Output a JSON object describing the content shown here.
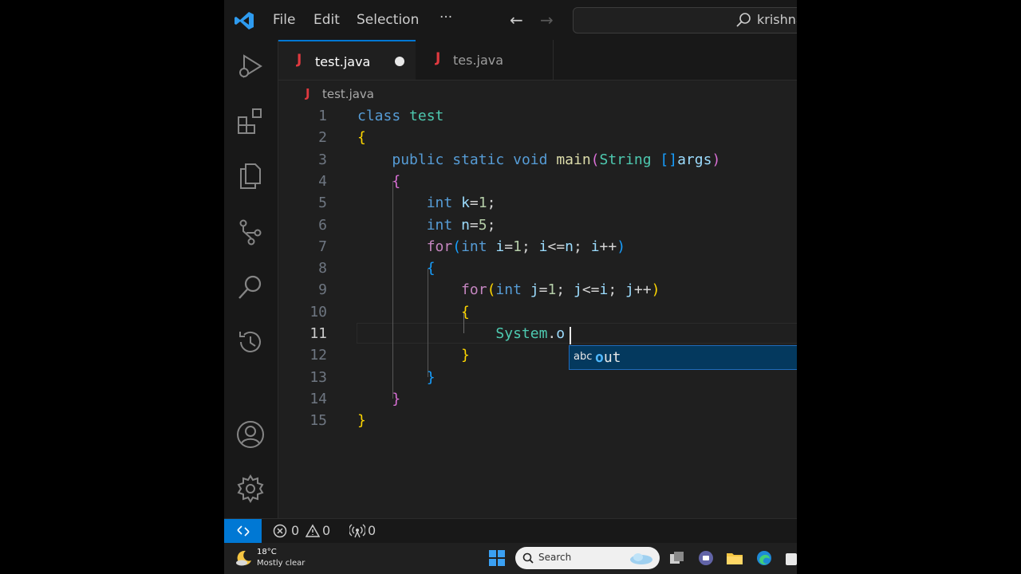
{
  "window": {
    "menu": {
      "file": "File",
      "edit": "Edit",
      "selection": "Selection",
      "more": "···"
    },
    "search": {
      "text": "krishna"
    }
  },
  "tabs": [
    {
      "label": "test.java",
      "icon": "J",
      "active": true,
      "dirty": true
    },
    {
      "label": "tes.java",
      "icon": "J",
      "active": false
    }
  ],
  "breadcrumb": {
    "icon": "J",
    "label": "test.java"
  },
  "editor": {
    "line_numbers": [
      "1",
      "2",
      "3",
      "4",
      "5",
      "6",
      "7",
      "8",
      "9",
      "10",
      "11",
      "12",
      "13",
      "14",
      "15"
    ],
    "active_line": "11",
    "code": [
      "class test",
      "{",
      "    public static void main(String []args)",
      "    {",
      "        int k=1;",
      "        int n=5;",
      "        for(int i=1; i<=n; i++)",
      "        {",
      "            for(int j=1; j<=i; j++)",
      "            {",
      "                System.o",
      "            }",
      "        }",
      "    }",
      "}"
    ]
  },
  "suggest": {
    "kind_icon": "abc",
    "match": "o",
    "rest": "ut"
  },
  "statusbar": {
    "errors": "0",
    "warnings": "0",
    "ports": "0"
  },
  "taskbar": {
    "temperature": "18°C",
    "weather": "Mostly clear",
    "search_placeholder": "Search"
  },
  "colors": {
    "accent": "#0078d4",
    "editor_bg": "#1f1f1f",
    "keyword": "#569cd6",
    "control": "#c586c0",
    "type": "#4ec9b0",
    "function": "#dcdcaa",
    "variable": "#9cdcfe",
    "number": "#b5cea8",
    "bracket1": "#ffd700",
    "bracket2": "#da70d6",
    "bracket3": "#179fff"
  }
}
